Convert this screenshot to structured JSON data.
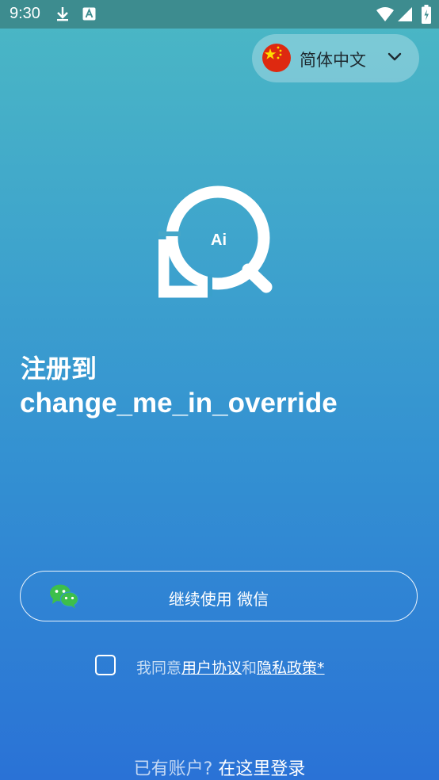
{
  "status_bar": {
    "time": "9:30"
  },
  "language": {
    "label": "简体中文",
    "flag": "china-flag"
  },
  "title": {
    "line1": "注册到",
    "line2": "change_me_in_override"
  },
  "logo": {
    "text": "Ai"
  },
  "wechat_button": {
    "label": "继续使用 微信",
    "icon": "wechat-icon"
  },
  "agreement": {
    "prefix": "我同意",
    "user_agreement": "用户协议",
    "and": "和",
    "privacy_policy": "隐私政策*"
  },
  "login": {
    "prompt": "已有账户?",
    "link": "在这里登录"
  },
  "colors": {
    "gradient_top": "#4bb8c4",
    "gradient_bottom": "#2a72d6",
    "status_bar": "#3d8c8f",
    "wechat_green": "#3dbf4b"
  }
}
